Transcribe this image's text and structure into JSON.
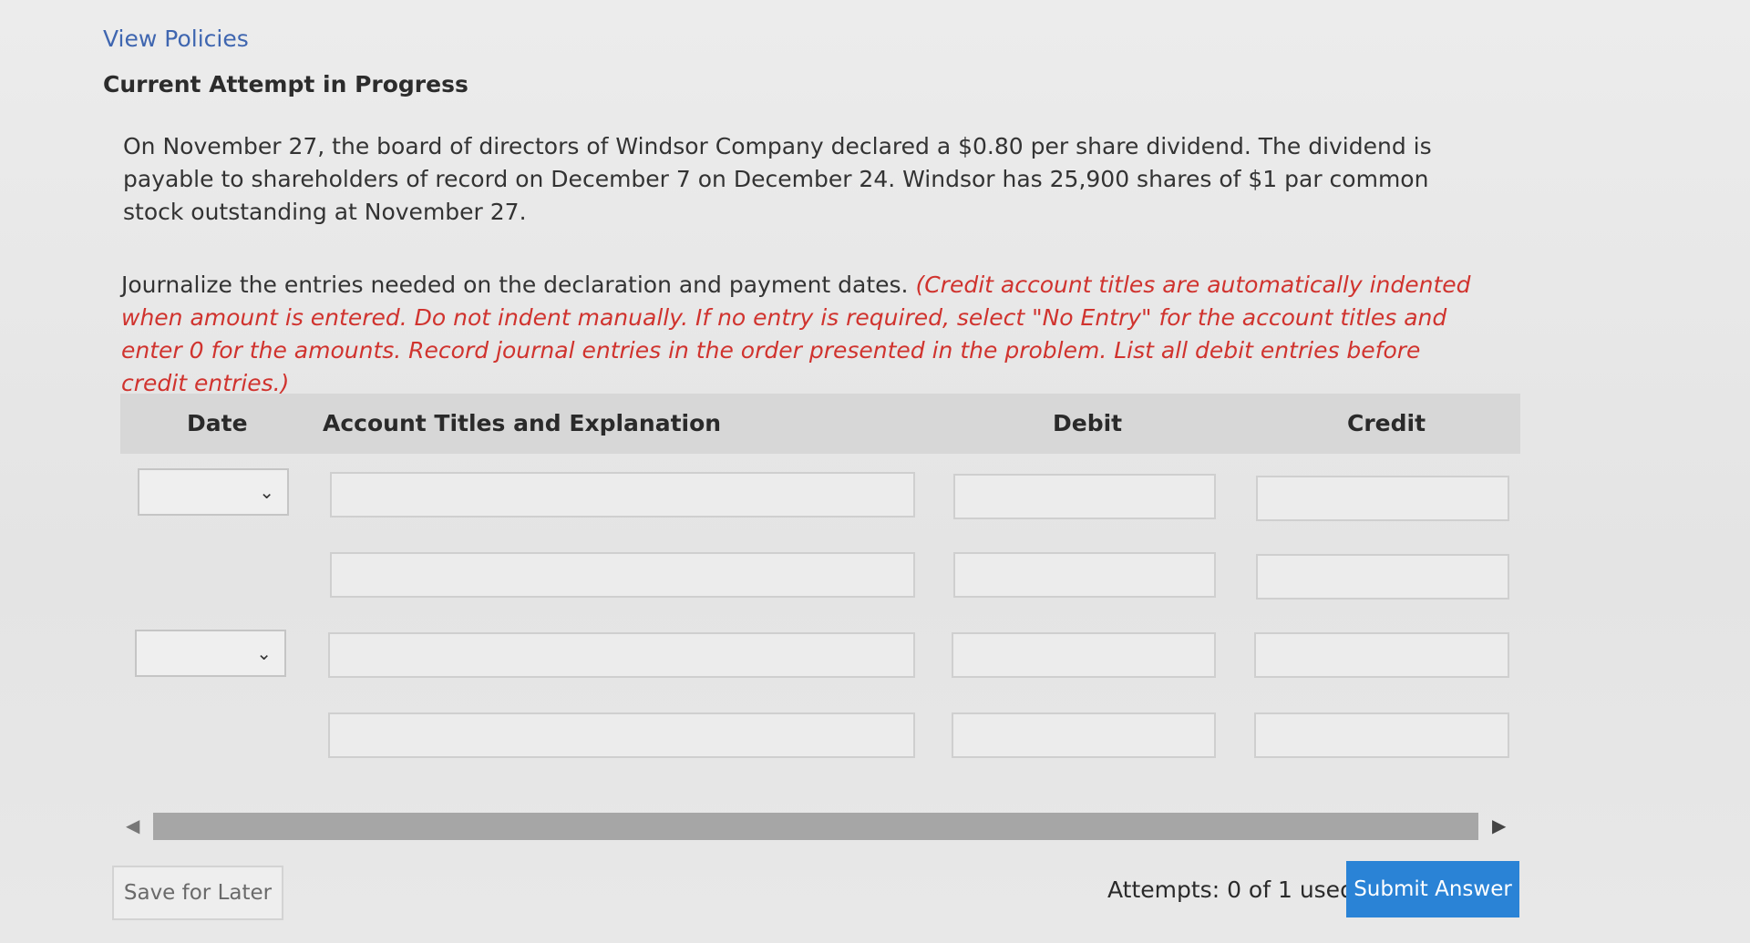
{
  "header": {
    "view_policies_link": "View Policies",
    "attempt_status": "Current Attempt in Progress"
  },
  "problem": {
    "text": "On November 27, the board of directors of Windsor Company declared a $0.80 per share dividend. The dividend is payable to shareholders of record on December 7 on December 24. Windsor has 25,900 shares of $1 par common stock outstanding at November 27."
  },
  "instructions": {
    "text": "Journalize the entries needed on the declaration and payment dates. ",
    "note": "(Credit account titles are automatically indented when amount is entered. Do not indent manually. If no entry is required, select \"No Entry\" for the account titles and enter 0 for the amounts. Record journal entries in the order presented in the problem. List all debit entries before credit entries.)"
  },
  "table": {
    "columns": {
      "date": "Date",
      "account": "Account Titles and Explanation",
      "debit": "Debit",
      "credit": "Credit"
    },
    "rows": [
      {
        "date": "",
        "account": "",
        "debit": "",
        "credit": ""
      },
      {
        "date": "",
        "account": "",
        "debit": "",
        "credit": ""
      },
      {
        "date": "",
        "account": "",
        "debit": "",
        "credit": ""
      },
      {
        "date": "",
        "account": "",
        "debit": "",
        "credit": ""
      }
    ]
  },
  "footer": {
    "save_label": "Save for Later",
    "attempts_text": "Attempts: 0 of 1 used",
    "submit_label": "Submit Answer"
  },
  "colors": {
    "link": "#3f66b0",
    "note_red": "#d0332e",
    "submit_blue": "#2a83d6",
    "header_bg": "#d7d7d7"
  }
}
